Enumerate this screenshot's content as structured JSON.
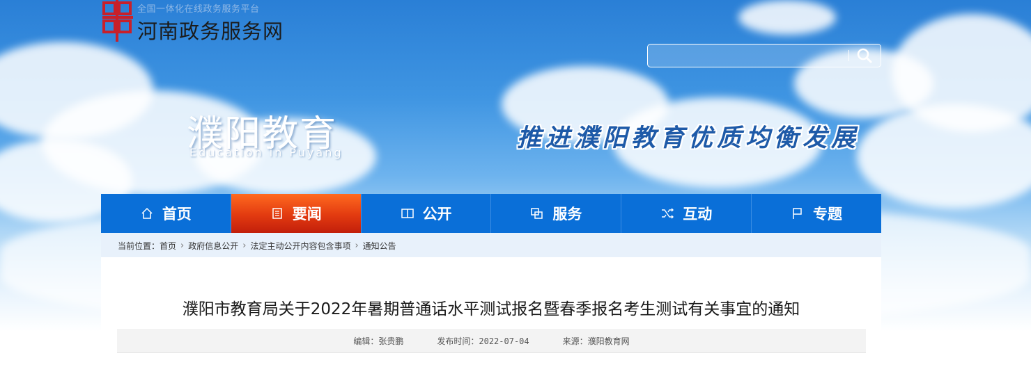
{
  "header": {
    "platform_sub": "全国一体化在线政务服务平台",
    "platform_title": "河南政务服务网",
    "logo_icon": "henan-gov-logo-icon"
  },
  "search": {
    "placeholder": "",
    "icon": "search-icon"
  },
  "banner": {
    "title_cn": "濮阳教育",
    "title_en": "Education in Puyang",
    "slogan": "推进濮阳教育优质均衡发展"
  },
  "nav": {
    "items": [
      {
        "label": "首页",
        "icon": "home-icon",
        "active": false
      },
      {
        "label": "要闻",
        "icon": "news-icon",
        "active": true
      },
      {
        "label": "公开",
        "icon": "book-icon",
        "active": false
      },
      {
        "label": "服务",
        "icon": "service-icon",
        "active": false
      },
      {
        "label": "互动",
        "icon": "shuffle-icon",
        "active": false
      },
      {
        "label": "专题",
        "icon": "flag-icon",
        "active": false
      }
    ]
  },
  "breadcrumb": {
    "prefix": "当前位置：",
    "items": [
      "首页",
      "政府信息公开",
      "法定主动公开内容包含事项",
      "通知公告"
    ]
  },
  "article": {
    "title": "濮阳市教育局关于2022年暑期普通话水平测试报名暨春季报名考生测试有关事宜的通知",
    "editor": "编辑：张贵鹏",
    "publish_time": "发布时间：2022-07-04",
    "source": "来源：濮阳教育网"
  },
  "colors": {
    "nav_bg": "#0a6fd8",
    "nav_active": "#e23a10",
    "breadcrumb_bg": "#e8f1fb",
    "slogan": "#1e5aa8"
  }
}
